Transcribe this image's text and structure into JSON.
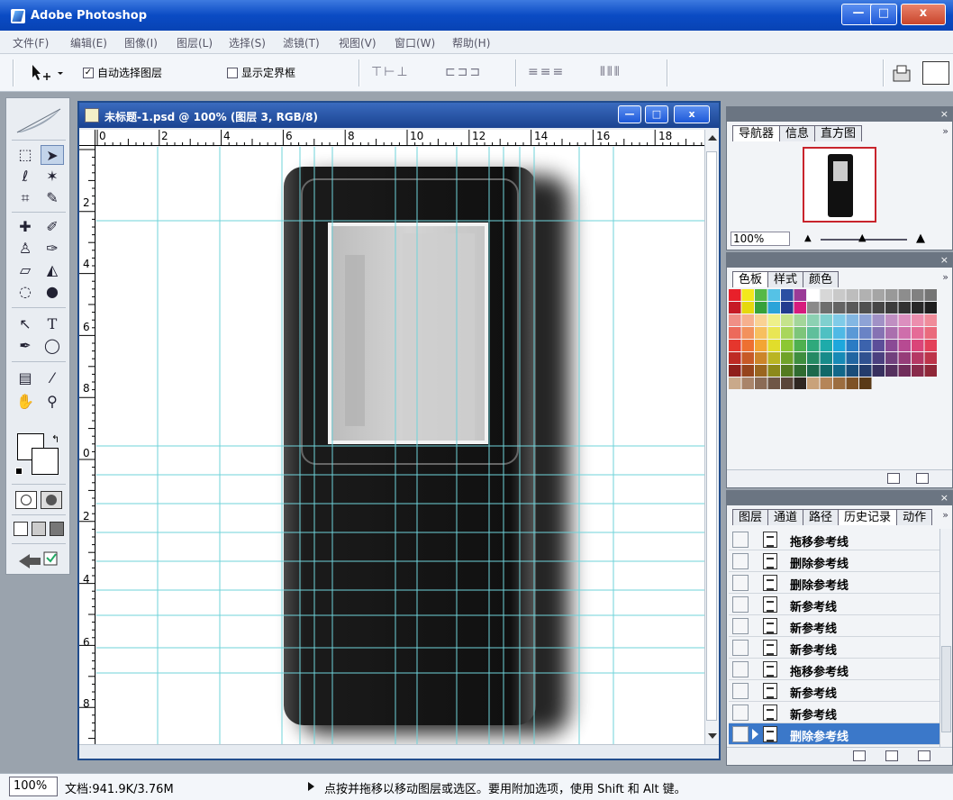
{
  "app": {
    "title": "Adobe Photoshop",
    "min_label": "—",
    "max_label": "□",
    "close_label": "x"
  },
  "menu": [
    "文件(F)",
    "编辑(E)",
    "图像(I)",
    "图层(L)",
    "选择(S)",
    "滤镜(T)",
    "视图(V)",
    "窗口(W)",
    "帮助(H)"
  ],
  "options": {
    "auto_select_label": "自动选择图层",
    "auto_select_checked": "✓",
    "show_bounds_label": "显示定界框",
    "align_icons_a": "⊤⊢⊥",
    "align_icons_b": "⊏⊐⊐",
    "dist_icons_a": "≡≡≡",
    "dist_icons_b": "⫴⫴⫴"
  },
  "document": {
    "title": "未标题-1.psd @ 100% (图层 3, RGB/8)",
    "min_label": "—",
    "max_label": "□",
    "close_label": "x",
    "ruler_top": [
      "0",
      "2",
      "4",
      "6",
      "8",
      "10",
      "12",
      "14",
      "16",
      "18"
    ],
    "ruler_left": [
      "2",
      "4",
      "6",
      "8",
      "0",
      "2",
      "4",
      "6",
      "8"
    ]
  },
  "navigator": {
    "tabs": [
      "导航器",
      "信息",
      "直方图"
    ],
    "zoom": "100%"
  },
  "swatches": {
    "tabs": [
      "色板",
      "样式",
      "颜色"
    ],
    "row1": [
      "#e8202a",
      "#f3e81c",
      "#55b948",
      "#55c2e6",
      "#2b4fa2",
      "#9a3b97",
      "#ffffff",
      "#d7d7d7",
      "#c9c9c9",
      "#bdbdbd",
      "#b1b1b1",
      "#a5a5a5",
      "#999999",
      "#8d8d8d",
      "#818181",
      "#757575"
    ],
    "row2": [
      "#c61b26",
      "#e5d80e",
      "#35a13a",
      "#2ba4d9",
      "#223b8f",
      "#d71b7d",
      "#8a8a8a",
      "#6e6e6e",
      "#646464",
      "#5a5a5a",
      "#505050",
      "#464646",
      "#3c3c3c",
      "#323232",
      "#282828",
      "#1e1e1e"
    ],
    "gradient_rows": [
      [
        "#f08f86",
        "#f6b08e",
        "#fad294",
        "#eef08a",
        "#c5e38c",
        "#a3d69a",
        "#8cd1b3",
        "#7fd0cf",
        "#7fcbe8",
        "#83b7e3",
        "#8ea3d6",
        "#a191c6",
        "#c08fc2",
        "#dc8fbf",
        "#ec8eae",
        "#f08c9a"
      ],
      [
        "#ec6a5b",
        "#f2915c",
        "#f7bf5f",
        "#e9e655",
        "#a9d65c",
        "#7dc57a",
        "#5fbf9b",
        "#4fc0c2",
        "#4fb9e5",
        "#5a99d6",
        "#6a83c5",
        "#8672b3",
        "#aa6fae",
        "#ce6eab",
        "#e56b97",
        "#ea6a7c"
      ],
      [
        "#e5362d",
        "#ee7031",
        "#f3a534",
        "#e1dd2b",
        "#8cc733",
        "#4fb04f",
        "#2fa97c",
        "#1eabaa",
        "#1ea7dc",
        "#2a7cc4",
        "#3c63ad",
        "#5c4e99",
        "#8a4b95",
        "#b74a92",
        "#da4579",
        "#e3415a"
      ],
      [
        "#be2a24",
        "#c75a27",
        "#cc8529",
        "#bab523",
        "#70a329",
        "#3e8e3f",
        "#258a64",
        "#178b8a",
        "#178ab6",
        "#2266a2",
        "#305190",
        "#4b407f",
        "#71417d",
        "#963d79",
        "#b53864",
        "#bd344a"
      ],
      [
        "#8f1f1b",
        "#96441d",
        "#9a651f",
        "#8c891a",
        "#547b1f",
        "#2f6b30",
        "#1c684c",
        "#116868",
        "#116789",
        "#194d7a",
        "#243c6c",
        "#38305f",
        "#55305e",
        "#712d5b",
        "#892a4b",
        "#8f2738"
      ]
    ],
    "last_row": [
      "#c9a98a",
      "#a9846a",
      "#8b6b56",
      "#6f5646",
      "#5a4539",
      "#2f2621",
      "#c9a27a",
      "#b58558",
      "#9c6d3f",
      "#7e5226",
      "#5a3a17"
    ]
  },
  "history": {
    "tabs": [
      "图层",
      "通道",
      "路径",
      "历史记录",
      "动作"
    ],
    "items": [
      "拖移参考线",
      "删除参考线",
      "删除参考线",
      "新参考线",
      "新参考线",
      "新参考线",
      "拖移参考线",
      "新参考线",
      "新参考线",
      "删除参考线"
    ]
  },
  "status": {
    "zoom": "100%",
    "doc_info": "文档:941.9K/3.76M",
    "message": "点按并拖移以移动图层或选区。要用附加选项，使用 Shift 和 Alt 键。"
  }
}
